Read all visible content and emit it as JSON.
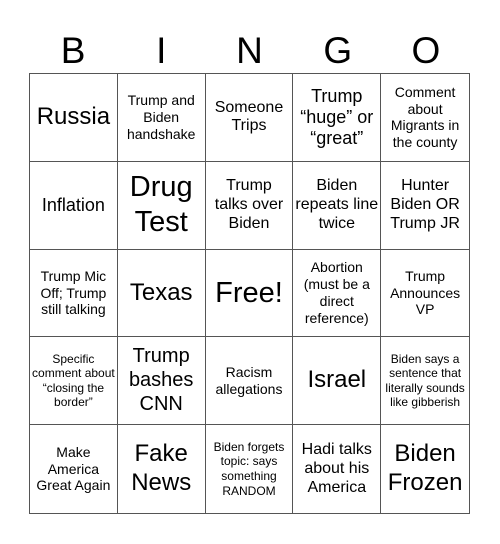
{
  "header": {
    "letters": [
      "B",
      "I",
      "N",
      "G",
      "O"
    ]
  },
  "board": {
    "cells": [
      "Russia",
      "Trump and Biden handshake",
      "Someone Trips",
      "Trump “huge” or “great”",
      "Comment about Migrants in the county",
      "Inflation",
      "Drug Test",
      "Trump talks over Biden",
      "Biden repeats line twice",
      "Hunter Biden OR Trump JR",
      "Trump Mic Off; Trump still talking",
      "Texas",
      "Free!",
      "Abortion (must be a direct reference)",
      "Trump Announces VP",
      "Specific comment about “closing the border”",
      "Trump bashes CNN",
      "Racism allegations",
      "Israel",
      "Biden says a sentence that literally sounds like gibberish",
      "Make America Great Again",
      "Fake News",
      "Biden forgets topic: says something RANDOM",
      "Hadi talks about his America",
      "Biden Frozen"
    ]
  }
}
